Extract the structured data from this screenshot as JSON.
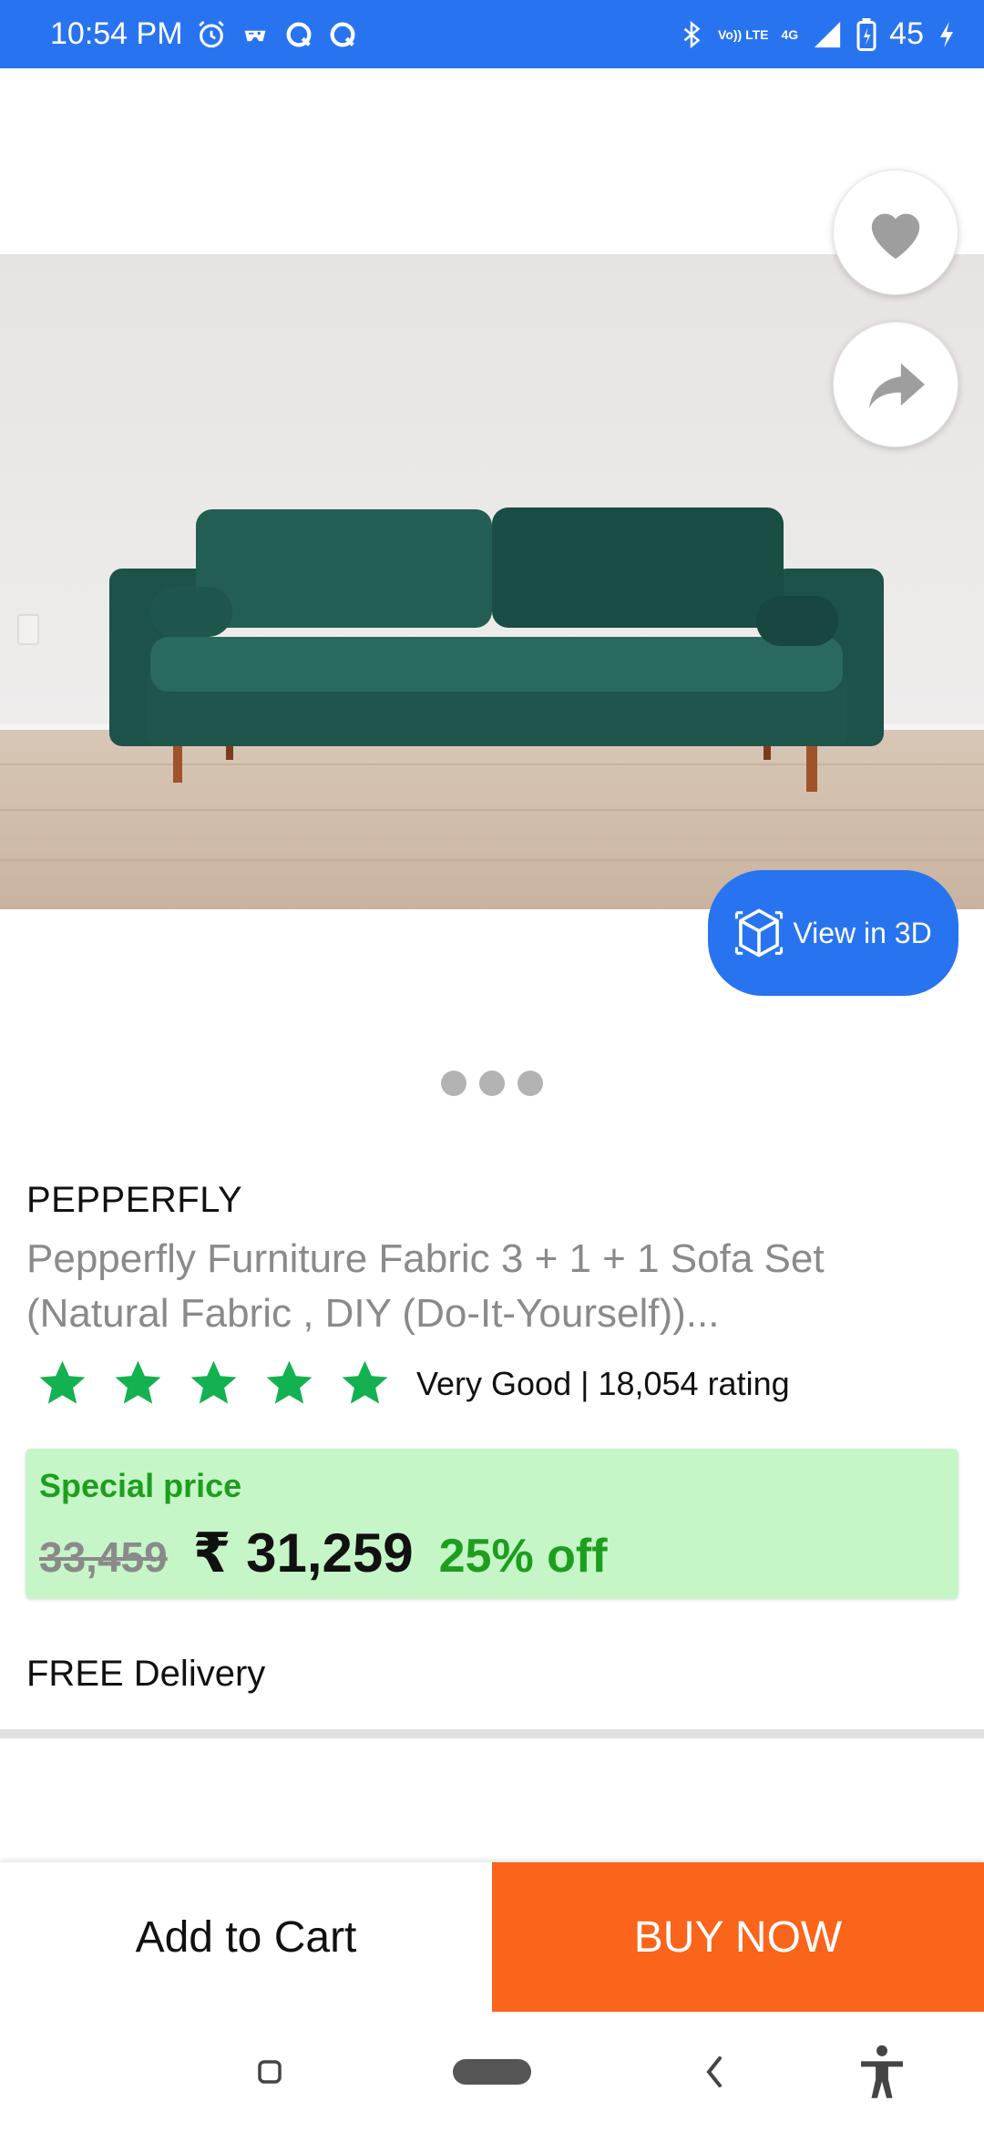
{
  "status_bar": {
    "time": "10:54 PM",
    "battery": "45",
    "network": "4G",
    "volte": "Vo)) LTE"
  },
  "product": {
    "brand": "PEPPERFLY",
    "title": "Pepperfly Furniture Fabric 3 + 1 + 1 Sofa Set (Natural Fabric , DIY (Do-It-Yourself))...",
    "rating_stars": 5,
    "rating_text": "Very Good | 18,054 rating",
    "image_count": 3,
    "view_3d_label": "View in 3D"
  },
  "price": {
    "label": "Special price",
    "original": "33,459",
    "current": "₹ 31,259",
    "discount": "25% off"
  },
  "delivery": "FREE Delivery",
  "actions": {
    "add_to_cart": "Add to Cart",
    "buy_now": "BUY NOW"
  },
  "colors": {
    "primary": "#2874f0",
    "buy_now": "#fb641b",
    "price_bg": "#c6f6c8",
    "discount_green": "#1e9e1e",
    "star_green": "#14b150"
  }
}
